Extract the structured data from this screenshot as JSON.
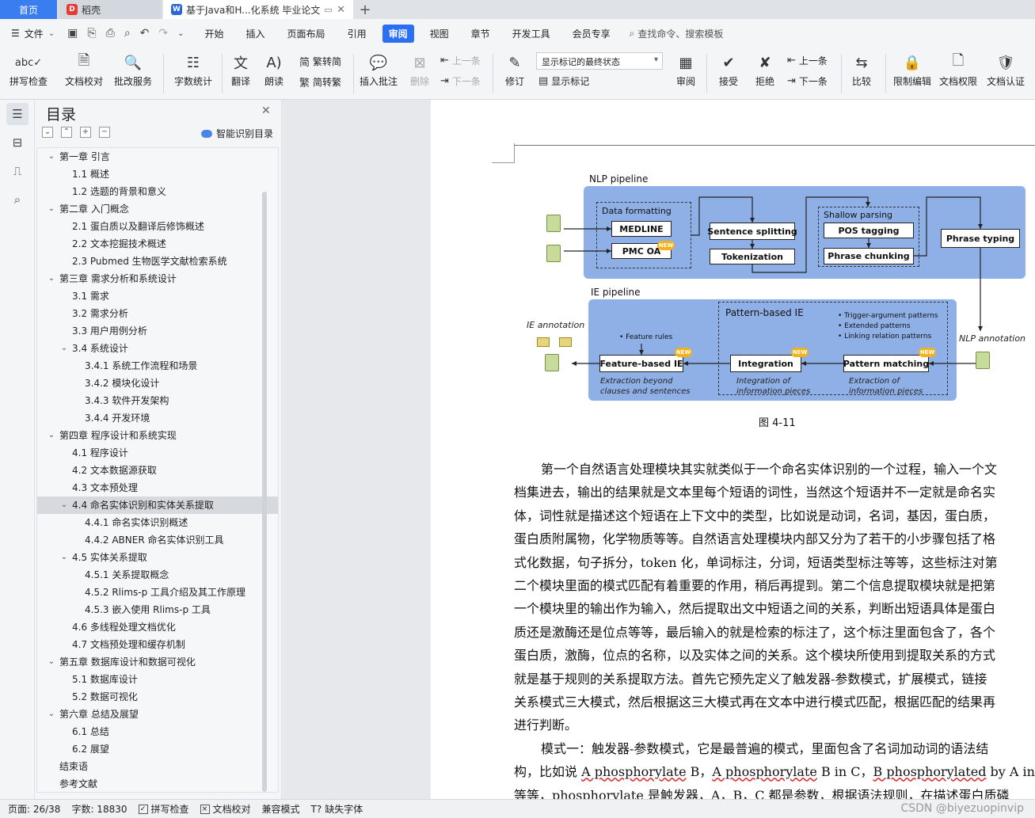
{
  "tabs": {
    "home": "首页",
    "daoke": "稻壳",
    "doc": "基于Java和H...化系统 毕业论文"
  },
  "menu": {
    "file": "文件",
    "tabs": [
      "开始",
      "插入",
      "页面布局",
      "引用",
      "审阅",
      "视图",
      "章节",
      "开发工具",
      "会员专享"
    ],
    "active_tab": "审阅",
    "search": "查找命令、搜索模板"
  },
  "ribbon": {
    "spell": "拼写检查",
    "proofread": "文档校对",
    "batch": "批改服务",
    "wordcount": "字数统计",
    "translate": "翻译",
    "read": "朗读",
    "to_trad": "繁转简",
    "to_simp": "简转繁",
    "insert_comment": "插入批注",
    "delete": "删除",
    "prev": "上一条",
    "next": "下一条",
    "revise": "修订",
    "markup_select": "显示标记的最终状态",
    "show_markup": "显示标记",
    "review": "审阅",
    "accept": "接受",
    "reject": "拒绝",
    "prev2": "上一条",
    "next2": "下一条",
    "compare": "比较",
    "restrict": "限制编辑",
    "permission": "文档权限",
    "certify": "文档认证"
  },
  "toc": {
    "title": "目录",
    "smart": "智能识别目录",
    "items": [
      {
        "text": "第一章  引言",
        "level": 0,
        "arrow": "v"
      },
      {
        "text": "1.1  概述",
        "level": 1,
        "arrow": ""
      },
      {
        "text": "1.2  选题的背景和意义",
        "level": 1,
        "arrow": ""
      },
      {
        "text": "第二章  入门概念",
        "level": 0,
        "arrow": "v"
      },
      {
        "text": "2.1  蛋白质以及翻译后修饰概述",
        "level": 1,
        "arrow": ""
      },
      {
        "text": "2.2 文本挖掘技术概述",
        "level": 1,
        "arrow": ""
      },
      {
        "text": "2.3 Pubmed 生物医学文献检索系统",
        "level": 1,
        "arrow": ""
      },
      {
        "text": "第三章  需求分析和系统设计",
        "level": 0,
        "arrow": "v"
      },
      {
        "text": "3.1 需求",
        "level": 1,
        "arrow": ""
      },
      {
        "text": "3.2  需求分析",
        "level": 1,
        "arrow": ""
      },
      {
        "text": "3.3  用户用例分析",
        "level": 1,
        "arrow": ""
      },
      {
        "text": "3.4  系统设计",
        "level": 1,
        "arrow": "v"
      },
      {
        "text": "3.4.1  系统工作流程和场景",
        "level": 2,
        "arrow": ""
      },
      {
        "text": "3.4.2  模块化设计",
        "level": 2,
        "arrow": ""
      },
      {
        "text": "3.4.3  软件开发架构",
        "level": 2,
        "arrow": ""
      },
      {
        "text": "3.4.4  开发环境",
        "level": 2,
        "arrow": ""
      },
      {
        "text": "第四章  程序设计和系统实现",
        "level": 0,
        "arrow": "v"
      },
      {
        "text": "4.1  程序设计",
        "level": 1,
        "arrow": ""
      },
      {
        "text": "4.2  文本数据源获取",
        "level": 1,
        "arrow": ""
      },
      {
        "text": "4.3  文本预处理",
        "level": 1,
        "arrow": ""
      },
      {
        "text": "4.4  命名实体识别和实体关系提取",
        "level": 1,
        "arrow": "v",
        "selected": true
      },
      {
        "text": "4.4.1 命名实体识别概述",
        "level": 2,
        "arrow": ""
      },
      {
        "text": "4.4.2 ABNER 命名实体识别工具",
        "level": 2,
        "arrow": ""
      },
      {
        "text": "4.5  实体关系提取",
        "level": 1,
        "arrow": "v"
      },
      {
        "text": "4.5.1  关系提取概念",
        "level": 2,
        "arrow": ""
      },
      {
        "text": "4.5.2 Rlims-p 工具介绍及其工作原理",
        "level": 2,
        "arrow": ""
      },
      {
        "text": "4.5.3  嵌入使用 Rlims-p 工具",
        "level": 2,
        "arrow": ""
      },
      {
        "text": "4.6  多线程处理文档优化",
        "level": 1,
        "arrow": ""
      },
      {
        "text": "4.7  文档预处理和缓存机制",
        "level": 1,
        "arrow": ""
      },
      {
        "text": "第五章  数据库设计和数据可视化",
        "level": 0,
        "arrow": "v"
      },
      {
        "text": "5.1 数据库设计",
        "level": 1,
        "arrow": ""
      },
      {
        "text": "5.2  数据可视化",
        "level": 1,
        "arrow": ""
      },
      {
        "text": "第六章  总结及展望",
        "level": 0,
        "arrow": "v"
      },
      {
        "text": "6.1  总结",
        "level": 1,
        "arrow": ""
      },
      {
        "text": "6.2  展望",
        "level": 1,
        "arrow": ""
      },
      {
        "text": "结束语",
        "level": -1,
        "arrow": ""
      },
      {
        "text": "参考文献",
        "level": -1,
        "arrow": ""
      }
    ]
  },
  "figure": {
    "nlp_title": "NLP pipeline",
    "data_formatting": "Data formatting",
    "medline": "MEDLINE",
    "pmc": "PMC OA",
    "sentence_splitting": "Sentence splitting",
    "tokenization": "Tokenization",
    "shallow_parsing": "Shallow parsing",
    "pos_tagging": "POS tagging",
    "phrase_chunking": "Phrase chunking",
    "phrase_typing": "Phrase typing",
    "ie_title": "IE pipeline",
    "ie_annotation": "IE annotation",
    "nlp_annotation": "NLP annotation",
    "pattern_based": "Pattern-based IE",
    "bullets": [
      "Trigger-argument patterns",
      "Extended patterns",
      "Linking relation patterns"
    ],
    "feature_rules": "Feature rules",
    "feature_ie": "Feature-based IE",
    "integration": "Integration",
    "pattern_matching": "Pattern matching",
    "extraction_beyond": [
      "Extraction beyond",
      "clauses and sentences"
    ],
    "integration_of": [
      "Integration of",
      "information pieces"
    ],
    "extraction_of": [
      "Extraction of",
      "information pieces"
    ],
    "new": "NEW",
    "caption": "图 4-11"
  },
  "body": {
    "p1": [
      "第一个自然语言处理模块其实就类似于一个命名实体识别的一个过程，输入一个文",
      "档集进去，输出的结果就是文本里每个短语的词性，当然这个短语并不一定就是命名实",
      "体，词性就是描述这个短语在上下文中的类型，比如说是动词，名词，基因，蛋白质，",
      "蛋白质附属物，化学物质等等。自然语言处理模块内部又分为了若干的小步骤包括了格",
      "式化数据，句子拆分，token 化，单词标注，分词，短语类型标注等等，这些标注对第",
      "二个模块里面的模式匹配有着重要的作用，稍后再提到。第二个信息提取模块就是把第",
      "一个模块里的输出作为输入，然后提取出文中短语之间的关系，判断出短语具体是蛋白",
      "质还是激酶还是位点等等，最后输入的就是检索的标注了，这个标注里面包含了，各个",
      "蛋白质，激酶，位点的名称，以及实体之间的关系。这个模块所使用到提取关系的方式",
      "就是基于规则的关系提取方法。首先它预先定义了触发器-参数模式，扩展模式，链接",
      "关系模式三大模式，然后根据这三大模式再在文本中进行模式匹配，根据匹配的结果再",
      "进行判断。"
    ],
    "p2_line1": "模式一：触发器-参数模式，它是最普遍的模式，里面包含了名词加动词的语法结",
    "p2_line2_a": "构，比如说 ",
    "p2_line2_b": "A phosphorylate",
    "p2_line2_c": " B，",
    "p2_line2_d": "A phosphorylate",
    "p2_line2_e": " B in C，",
    "p2_line2_f": "B phosphorylated",
    "p2_line2_g": " by A in C",
    "p2_line3": "等等，phosphorylate 是触发器，A，B，C 都是参数，根据语法规则，在描述蛋白质磷"
  },
  "status": {
    "page": "页面: 26/38",
    "words": "字数: 18830",
    "spell": "拼写检查",
    "proof": "文档校对",
    "compat": "兼容模式",
    "font": "缺失字体",
    "watermark": "CSDN @biyezuopinvip"
  },
  "colors": {
    "accent": "#2b6ff2",
    "panel_blue": "#8fb0e6",
    "new_badge": "#f3b21c"
  }
}
